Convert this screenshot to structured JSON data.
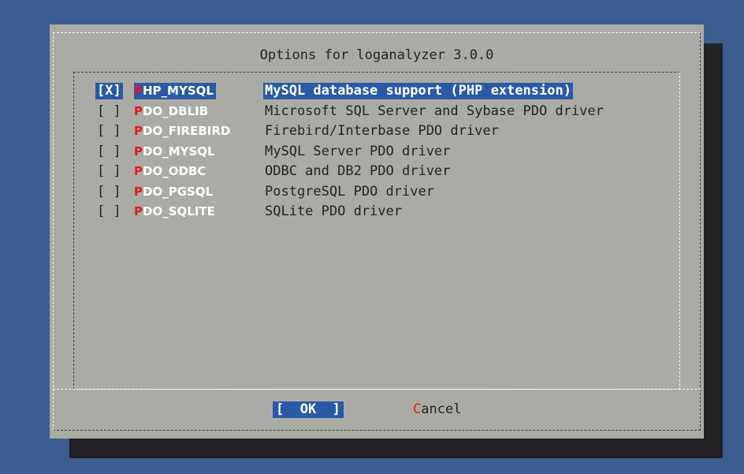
{
  "dialog": {
    "title": "Options for loganalyzer 3.0.0"
  },
  "options": [
    {
      "checkbox": "[X]",
      "hotkey": "P",
      "rest": "HP_MYSQL",
      "description": "MySQL database support (PHP extension)",
      "checked": true,
      "selected": true
    },
    {
      "checkbox": "[ ]",
      "hotkey": "P",
      "rest": "DO_DBLIB",
      "description": "Microsoft SQL Server and Sybase PDO driver",
      "checked": false,
      "selected": false
    },
    {
      "checkbox": "[ ]",
      "hotkey": "P",
      "rest": "DO_FIREBIRD",
      "description": "Firebird/Interbase PDO driver",
      "checked": false,
      "selected": false
    },
    {
      "checkbox": "[ ]",
      "hotkey": "P",
      "rest": "DO_MYSQL",
      "description": "MySQL Server PDO driver",
      "checked": false,
      "selected": false
    },
    {
      "checkbox": "[ ]",
      "hotkey": "P",
      "rest": "DO_ODBC",
      "description": "ODBC and DB2 PDO driver",
      "checked": false,
      "selected": false
    },
    {
      "checkbox": "[ ]",
      "hotkey": "P",
      "rest": "DO_PGSQL",
      "description": "PostgreSQL PDO driver",
      "checked": false,
      "selected": false
    },
    {
      "checkbox": "[ ]",
      "hotkey": "P",
      "rest": "DO_SQLITE",
      "description": "SQLite PDO driver",
      "checked": false,
      "selected": false
    }
  ],
  "buttons": {
    "ok_label": "[  OK  ]",
    "cancel_hotkey": "C",
    "cancel_rest": "ancel"
  },
  "colors": {
    "screen_bg": "#3c5d8f",
    "dialog_bg": "#ababa5",
    "highlight": "#2a5aa6",
    "hotkey": "#e11a1a"
  }
}
